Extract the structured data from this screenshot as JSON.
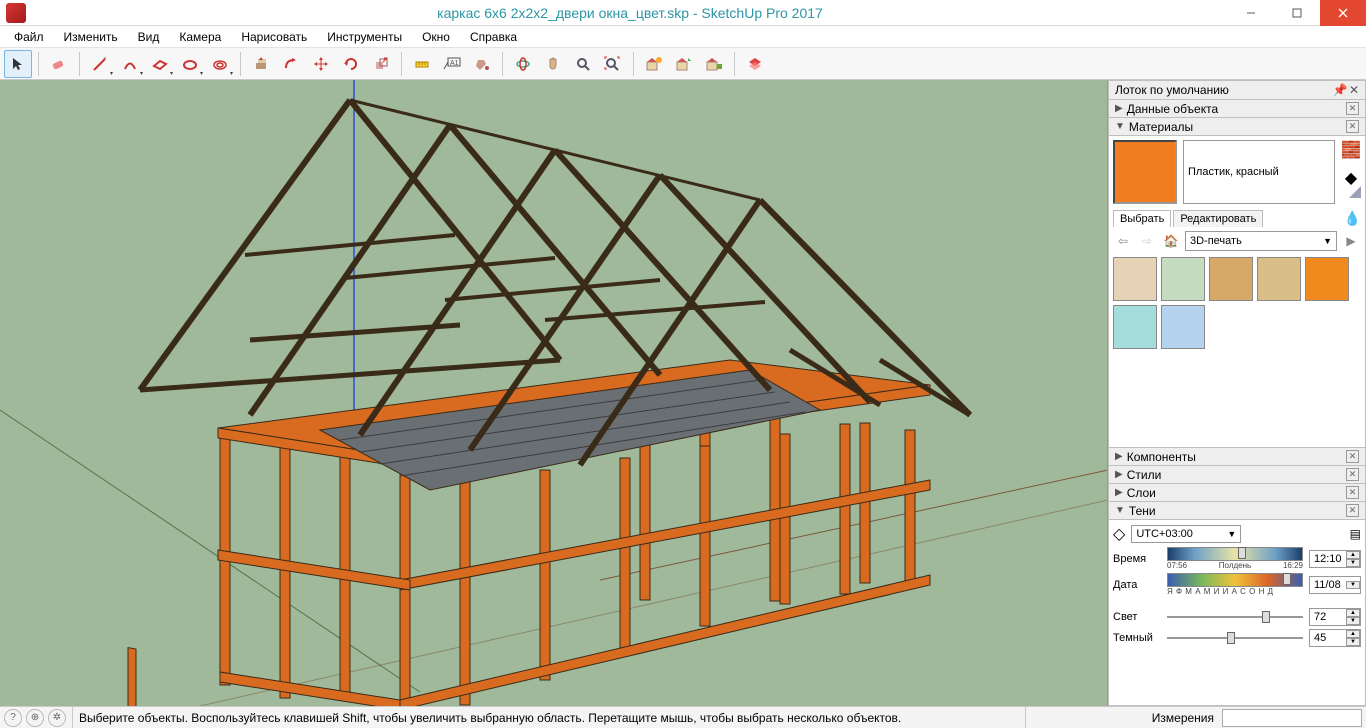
{
  "title": "каркас 6x6 2x2x2_двери окна_цвет.skp - SketchUp Pro 2017",
  "menus": [
    "Файл",
    "Изменить",
    "Вид",
    "Камера",
    "Нарисовать",
    "Инструменты",
    "Окно",
    "Справка"
  ],
  "toolbar_icons": [
    {
      "name": "select-arrow",
      "c": "#333"
    },
    {
      "name": "eraser",
      "c": "#e67"
    },
    {
      "name": "pencil",
      "c": "#c33",
      "dd": true
    },
    {
      "name": "arc",
      "c": "#c33",
      "dd": true
    },
    {
      "name": "rectangle",
      "c": "#c33",
      "dd": true
    },
    {
      "name": "circle",
      "c": "#c33",
      "dd": true
    },
    {
      "name": "polygon",
      "c": "#c33",
      "dd": true
    },
    {
      "name": "pushpull",
      "c": "#866"
    },
    {
      "name": "offset",
      "c": "#c33"
    },
    {
      "name": "move",
      "c": "#c33"
    },
    {
      "name": "rotate",
      "c": "#c33"
    },
    {
      "name": "scale",
      "c": "#c77"
    },
    {
      "name": "tape",
      "c": "#c90"
    },
    {
      "name": "text",
      "c": "#333"
    },
    {
      "name": "paint",
      "c": "#c77"
    },
    {
      "name": "orbit",
      "c": "#5a9"
    },
    {
      "name": "pan",
      "c": "#c9a46a"
    },
    {
      "name": "zoom",
      "c": "#556"
    },
    {
      "name": "zoom-extents",
      "c": "#556"
    },
    {
      "name": "warehouse-get",
      "c": "#a44"
    },
    {
      "name": "warehouse-share",
      "c": "#a44"
    },
    {
      "name": "warehouse-ext",
      "c": "#a44"
    },
    {
      "name": "layout",
      "c": "#a44"
    }
  ],
  "tray": {
    "title": "Лоток по умолчанию",
    "panels": {
      "entity": "Данные объекта",
      "materials": "Материалы",
      "components": "Компоненты",
      "styles": "Стили",
      "layers": "Слои",
      "shadows": "Тени"
    }
  },
  "materials": {
    "current_name": "Пластик, красный",
    "current_color": "#f07d20",
    "tabs": {
      "select": "Выбрать",
      "edit": "Редактировать"
    },
    "category": "3D-печать",
    "swatches": [
      "#e6d3b5",
      "#c5dcc1",
      "#d6a968",
      "#d9bf87",
      "#f08a1f",
      "#a5dcdc",
      "#b5d3ee"
    ]
  },
  "shadows": {
    "timezone": "UTC+03:00",
    "time_min": "07:56",
    "time_noon": "Полдень",
    "time_max": "16:29",
    "time_value": "12:10",
    "date_months": "Я Ф М А М И И А С О Н Д",
    "date_value": "11/08",
    "light_label": "Свет",
    "light_value": "72",
    "dark_label": "Темный",
    "dark_value": "45",
    "time_label": "Время",
    "date_label": "Дата"
  },
  "status": {
    "hint": "Выберите объекты. Воспользуйтесь клавишей Shift, чтобы увеличить выбранную область. Перетащите мышь, чтобы выбрать несколько объектов.",
    "measure_label": "Измерения"
  }
}
